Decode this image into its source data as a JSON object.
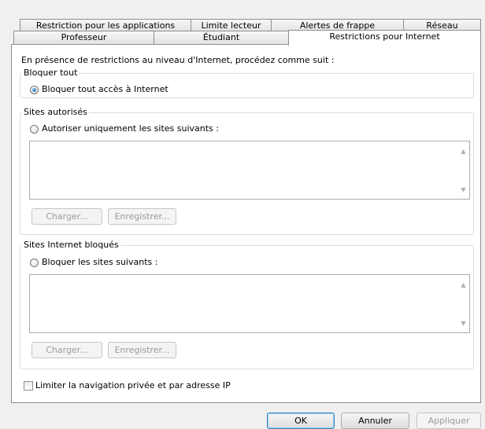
{
  "tabs_row1": [
    {
      "label": "Restriction pour les applications"
    },
    {
      "label": "Limite lecteur"
    },
    {
      "label": "Alertes de frappe"
    },
    {
      "label": "Réseau"
    }
  ],
  "tabs_row2": [
    {
      "label": "Professeur"
    },
    {
      "label": "Étudiant"
    },
    {
      "label": "Restrictions pour Internet",
      "active": true
    }
  ],
  "intro_text": "En présence de restrictions au niveau d'Internet, procédez comme suit :",
  "block_all": {
    "legend": "Bloquer tout",
    "radio_label": "Bloquer tout accès à Internet",
    "checked": true
  },
  "allowed_sites": {
    "legend": "Sites autorisés",
    "radio_label": "Autoriser uniquement les sites suivants :",
    "checked": false,
    "load_label": "Charger...",
    "save_label": "Enregistrer..."
  },
  "blocked_sites": {
    "legend": "Sites Internet bloqués",
    "radio_label": "Bloquer les sites suivants :",
    "checked": false,
    "load_label": "Charger...",
    "save_label": "Enregistrer..."
  },
  "private_browsing": {
    "label": "Limiter la navigation privée et par adresse IP",
    "checked": false
  },
  "footer": {
    "ok_label": "OK",
    "cancel_label": "Annuler",
    "apply_label": "Appliquer"
  }
}
